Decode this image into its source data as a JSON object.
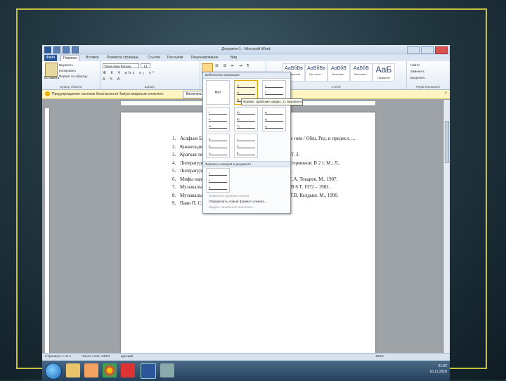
{
  "window": {
    "title": "Документ1 - Microsoft Word"
  },
  "ribbon": {
    "tabs": [
      "Файл",
      "Главная",
      "Вставка",
      "Разметка страницы",
      "Ссылки",
      "Рассылки",
      "Рецензирование",
      "Вид"
    ],
    "clipboard": {
      "paste": "Вставить",
      "cut": "Вырезать",
      "copy": "Копировать",
      "format_painter": "Формат по образцу",
      "group": "Буфер обмена"
    },
    "font": {
      "name": "Times New Roman",
      "size": "14",
      "group": "Шрифт"
    },
    "paragraph": {
      "group": "Абзац"
    },
    "styles": {
      "items": [
        {
          "sample": "АаБбВв",
          "name": "Обычный"
        },
        {
          "sample": "АаБбВв",
          "name": "Без инте..."
        },
        {
          "sample": "АаБбВ",
          "name": "Заголово..."
        },
        {
          "sample": "АаБбВ",
          "name": "Заголово..."
        },
        {
          "sample": "АаБ",
          "name": "Название"
        }
      ],
      "change": "Изменить стили",
      "group": "Стили"
    },
    "editing": {
      "find": "Найти",
      "replace": "Заменить",
      "select": "Выделить",
      "group": "Редактирование"
    }
  },
  "security_bar": {
    "message": "Предупреждение системы безопасности  Запуск макросов отключен.",
    "button": "Включить содержимое"
  },
  "gallery": {
    "header": "Библиотека нумерации",
    "none_label": "Нет",
    "tooltip": "Формат: арабские цифры, 1), выровнять...",
    "section_doc": "Форматы номеров в документе",
    "menu": [
      "Изменить уровень списка",
      "Определить новый формат номера...",
      "Задать начальное значение..."
    ],
    "formats": [
      [
        "1)",
        "2)",
        "3)"
      ],
      [
        "1.",
        "2.",
        "3."
      ],
      [
        "I.",
        "II.",
        "III."
      ],
      [
        "A)",
        "B)",
        "C)"
      ],
      [
        "a)",
        "b)",
        "c)"
      ],
      [
        "a.",
        "b.",
        "c."
      ],
      [
        "i.",
        "ii.",
        "iii."
      ]
    ]
  },
  "document": {
    "items": [
      {
        "num": "1.",
        "text": "Асафьев Б.В. Музыкальная форма как процесс. Пер. с нем / Общ. Ред. и предисл. ..."
      },
      {
        "num": "2.",
        "text": "Кинкельдей О. ... 1966."
      },
      {
        "num": "3.",
        "text": "Краткая литературная энциклопедия. М., 1962-1978. Т. 3."
      },
      {
        "num": "4.",
        "text": "Литературная энциклопедия: Словарь литературных терминов: В 2 т. М.; Л.."
      },
      {
        "num": "5.",
        "text": "Литературный энциклопедический словарь. М., 1987."
      },
      {
        "num": "6.",
        "text": "Мифы народов мира: Энциклопедия: В 2 т. / гл. ред С.А. Токарев. М., 1987."
      },
      {
        "num": "7.",
        "text": "Музыкальная энциклопедия / гл. ред. Келдыш Ю.В.: В 6 Т. 1972 – 1982."
      },
      {
        "num": "8.",
        "text": "Музыкальный энциклопедический словарь / гл. ред. Г.В. Келдыш. М., 1990."
      },
      {
        "num": "9.",
        "text": "Пави П. Словарь театра / Пер. с франц. М., 1991."
      }
    ]
  },
  "statusbar": {
    "page": "Страница: 1 из 1",
    "words": "Число слов: 24/94",
    "lang": "русский",
    "zoom": "100%"
  },
  "taskbar": {
    "time": "21:02",
    "date": "16.11.2018"
  },
  "colors": {
    "frame": "#c8c040",
    "word_blue": "#2b579a",
    "security_bar": "#fff4c2"
  }
}
